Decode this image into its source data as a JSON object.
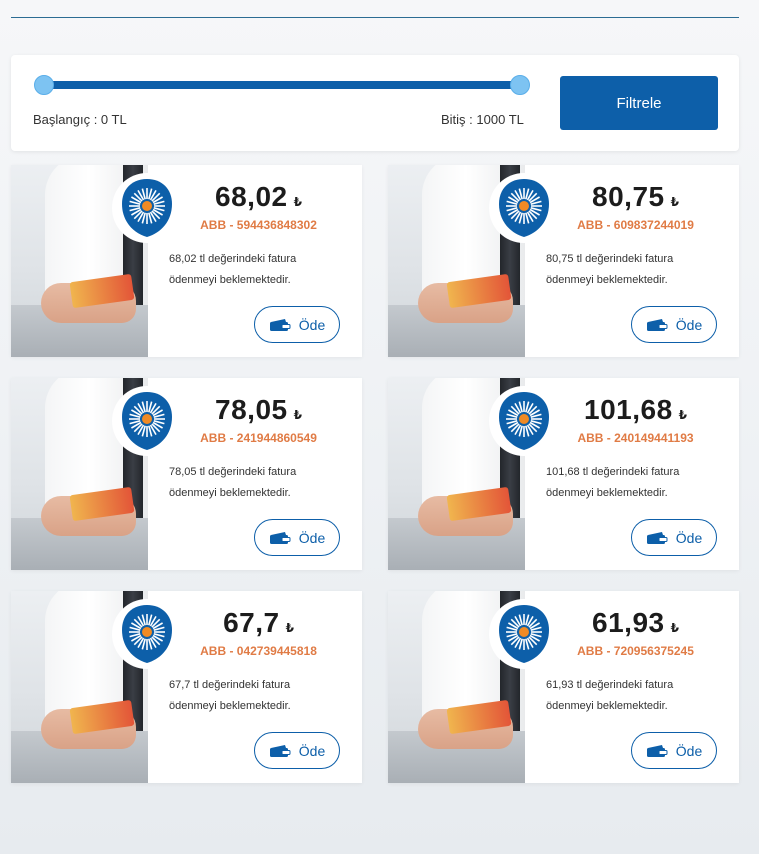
{
  "filter": {
    "start_label": "Başlangıç : 0 TL",
    "end_label": "Bitiş : 1000 TL",
    "button_label": "Filtrele",
    "range_min": 0,
    "range_max": 1000,
    "selected_min": 0,
    "selected_max": 1000
  },
  "colors": {
    "accent": "#0d5fa9",
    "subscriber": "#e07b45",
    "slider_handle": "#7dc3f2"
  },
  "bills": [
    {
      "amount": "68,02",
      "currency": "₺",
      "subscriber": "ABB - 594436848302",
      "description": "68,02 tl değerindeki fatura ödenmeyi beklemektedir.",
      "pay_label": "Öde",
      "logo_icon": "abb-sun-logo-icon",
      "pay_icon": "wallet-icon"
    },
    {
      "amount": "80,75",
      "currency": "₺",
      "subscriber": "ABB - 609837244019",
      "description": "80,75 tl değerindeki fatura ödenmeyi beklemektedir.",
      "pay_label": "Öde",
      "logo_icon": "abb-sun-logo-icon",
      "pay_icon": "wallet-icon"
    },
    {
      "amount": "78,05",
      "currency": "₺",
      "subscriber": "ABB - 241944860549",
      "description": "78,05 tl değerindeki fatura ödenmeyi beklemektedir.",
      "pay_label": "Öde",
      "logo_icon": "abb-sun-logo-icon",
      "pay_icon": "wallet-icon"
    },
    {
      "amount": "101,68",
      "currency": "₺",
      "subscriber": "ABB - 240149441193",
      "description": "101,68 tl değerindeki fatura ödenmeyi beklemektedir.",
      "pay_label": "Öde",
      "logo_icon": "abb-sun-logo-icon",
      "pay_icon": "wallet-icon"
    },
    {
      "amount": "67,7",
      "currency": "₺",
      "subscriber": "ABB - 042739445818",
      "description": "67,7 tl değerindeki fatura ödenmeyi beklemektedir.",
      "pay_label": "Öde",
      "logo_icon": "abb-sun-logo-icon",
      "pay_icon": "wallet-icon"
    },
    {
      "amount": "61,93",
      "currency": "₺",
      "subscriber": "ABB - 720956375245",
      "description": "61,93 tl değerindeki fatura ödenmeyi beklemektedir.",
      "pay_label": "Öde",
      "logo_icon": "abb-sun-logo-icon",
      "pay_icon": "wallet-icon"
    }
  ]
}
